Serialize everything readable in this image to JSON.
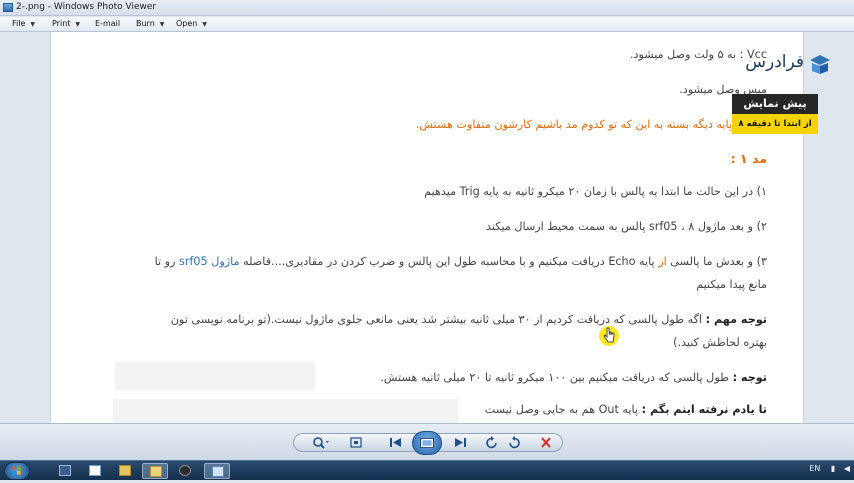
{
  "window": {
    "title": "2-.png - Windows Photo Viewer"
  },
  "menu": [
    {
      "label": "File"
    },
    {
      "label": "Print"
    },
    {
      "label": "E-mail"
    },
    {
      "label": "Burn"
    },
    {
      "label": "Open"
    }
  ],
  "doc": {
    "line1": "Vcc : به ۵ ولت وصل میشود.",
    "line2": "میس وصل میشود.",
    "line3": "اما سه پایه دیگه بسته به این که تو کدوم مد باشیم کارشون متفاوت هستش.",
    "mode_heading": "مد ۱ :",
    "step1_pre": "۱) در این حالت ما ابتدا یه پالس با زمان ۲۰ میکرو ثانیه به پایه ",
    "step1_trig": "Trig",
    "step1_post": " میدهیم",
    "step2_pre": "۲) و بعد ماژول ",
    "step2_module": "srf05",
    "step2_post": " ، ۸ پالس به سمت محیط ارسال میکند",
    "step3_a": "۳) و بعدش ما پالسی ",
    "step3_az": "از",
    "step3_b": " پایه Echo دریافت میکنیم و با محاسبه طول این پالس و ضرب کردن در مقادیری....فاصله ",
    "step3_module": "ماژول srf05",
    "step3_c": " رو تا",
    "step3_line2": "مانع پیدا میکنیم",
    "note1_label": "توجه مهم :",
    "note1_text": " اگه طول پالسی که دریافت کردیم از ۳۰ میلی ثانیه بیشتر شد یعنی مانعی جلوی ماژول نیست.(تو برنامه نویسی تون",
    "note1_line2": "بهتره لحاظش کنید.)",
    "note2_label": "توجه :",
    "note2_text": " طول پالسی که دریافت میکنیم بین ۱۰۰ میکرو ثانیه تا ۲۰ میلی ثانیه هستش.",
    "note3_label": "تا یادم نرفته اینم بگم :",
    "note3_text": " پایه Out هم به جایی وصل نیست"
  },
  "overlay": {
    "logo_text": "فرادرس",
    "preview_title": "پیش نمایش",
    "preview_subtitle": "از ابتدا تا دقیقه ۸"
  },
  "toolbar": {
    "buttons": [
      "zoom",
      "fit-window",
      "previous",
      "slideshow",
      "next",
      "rotate-ccw",
      "rotate-cw",
      "delete"
    ]
  },
  "taskbar": {
    "lang": "EN",
    "accent": "#1d4f86"
  },
  "colors": {
    "orange": "#e36c0a",
    "blue": "#2e74b5",
    "badge_dark": "#262626",
    "badge_yellow": "#f5d300"
  }
}
